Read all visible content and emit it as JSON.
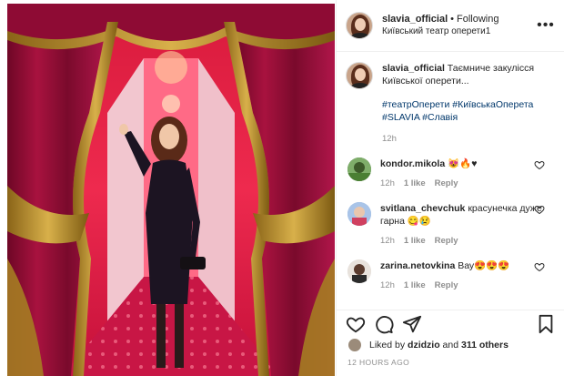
{
  "post": {
    "username": "slavia_official",
    "follow_state": "Following",
    "location": "Київський театр оперети1",
    "more_label": "•••"
  },
  "caption": {
    "username": "slavia_official",
    "text": "Таємниче закулісся Київської оперети...",
    "hashtags": "#театрОперети #КиївськаОперета #SLAVIA #Славія",
    "time": "12h"
  },
  "comments": [
    {
      "username": "kondor.mikola",
      "text": "😻🔥♥",
      "time": "12h",
      "likes": "1 like",
      "reply": "Reply"
    },
    {
      "username": "svitlana_chevchuk",
      "text": "красунечка дуже гарна 😋😢",
      "time": "12h",
      "likes": "1 like",
      "reply": "Reply"
    },
    {
      "username": "zarina.netovkina",
      "text": "Вау😍😍😍",
      "time": "12h",
      "likes": "1 like",
      "reply": "Reply"
    }
  ],
  "likes": {
    "prefix": "Liked by",
    "first_user": "dzidzio",
    "connector": "and",
    "others": "311 others"
  },
  "timestamp": "12 HOURS AGO",
  "colors": {
    "link": "#00376b",
    "muted": "#8e8e8e",
    "curtain_red": "#9e0f3a",
    "gold": "#c49a2a"
  },
  "icons": {
    "like": "heart-outline-icon",
    "comment": "speech-bubble-icon",
    "share": "paper-plane-icon",
    "save": "bookmark-icon"
  }
}
